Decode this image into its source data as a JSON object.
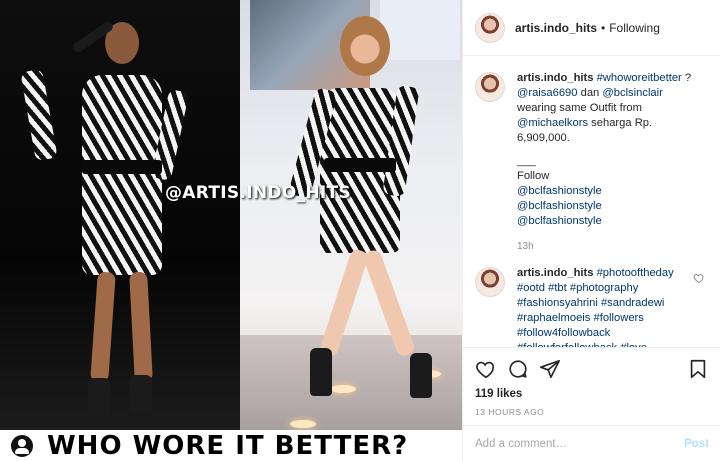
{
  "media": {
    "watermark": "@ARTIS.INDO_HITS",
    "caption_text": "WHO WORE IT BETTER?",
    "caption_icon": "user-circle-icon"
  },
  "header": {
    "username": "artis.indo_hits",
    "separator": "•",
    "follow_state": "Following"
  },
  "comments": [
    {
      "username": "artis.indo_hits",
      "hashtag": "#whoworeitbetter",
      "text_1": " ?",
      "mention_1": "@raisa6690",
      "text_2": " dan ",
      "mention_2": "@bclsinclair",
      "text_3": " wearing same Outfit from ",
      "mention_3": "@michaelkors",
      "text_4": " seharga Rp. 6,909,000.",
      "rule": "___",
      "follow_label": "Follow",
      "follow_links": [
        "@bclfashionstyle",
        "@bclfashionstyle",
        "@bclfashionstyle"
      ],
      "time": "13h"
    },
    {
      "username": "artis.indo_hits",
      "tags": "#photooftheday #ootd #tbt #photography #fashionsyahrini #sandradewi #raphaelmoeis #followers #follow4followback #followforfollowback #love #syahrini #lunamaya #raffiahmad #nagitaslavina #gonzomo"
    }
  ],
  "actions": {
    "like_icon": "heart-outline-icon",
    "comment_icon": "speech-bubble-icon",
    "share_icon": "paper-plane-icon",
    "save_icon": "bookmark-icon",
    "likes": "119 likes",
    "timestamp": "13 HOURS AGO"
  },
  "add_comment": {
    "placeholder": "Add a comment…",
    "post_label": "Post"
  },
  "colors": {
    "link": "#00376b",
    "muted": "#8e8e8e",
    "post_disabled": "#b2dffc"
  }
}
